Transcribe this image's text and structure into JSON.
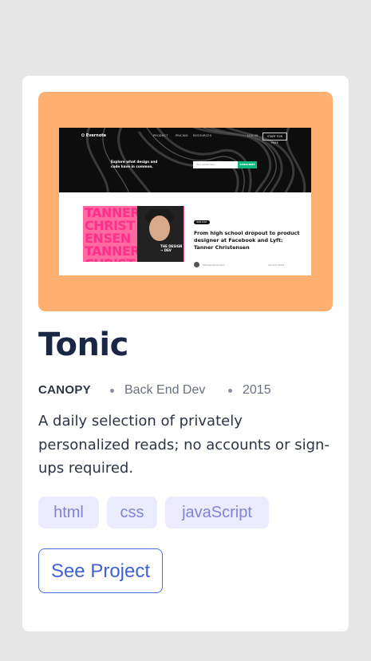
{
  "project": {
    "title": "Tonic",
    "company": "CANOPY",
    "role": "Back End Dev",
    "year": "2015",
    "description": "A daily selection of privately personalized reads; no accounts or sign-ups required.",
    "tags": [
      "html",
      "css",
      "javaScript"
    ],
    "cta_label": "See Project"
  },
  "screenshot": {
    "logo": "⭘ Evernote",
    "nav": [
      "PRODUCT",
      "PRICING",
      "RESOURCES",
      "LOG IN"
    ],
    "nav_button": "START FOR FREE",
    "hero_title": "Explore what design and code have in common.",
    "email_placeholder": "Your email here",
    "subscribe": "SUBSCRIBE",
    "poster_text": "TANNER CHRISTENSEN TANNER CHRISTENSEN",
    "poster_badge": "THE DESIGN → DEV",
    "pill": "NEW POST",
    "headline": "From high school dropout to product designer at Facebook and Lyft: Tanner Christensen",
    "author": "Michael Rostoutov",
    "date": "20 April 2019"
  },
  "colors": {
    "page_bg": "#e6e6e6",
    "card_bg": "#ffffff",
    "thumbnail_bg": "#ffb071",
    "title": "#1a2744",
    "tag_bg": "#ebebfe",
    "tag_text": "#7f84d6",
    "accent": "#3f62d4"
  }
}
